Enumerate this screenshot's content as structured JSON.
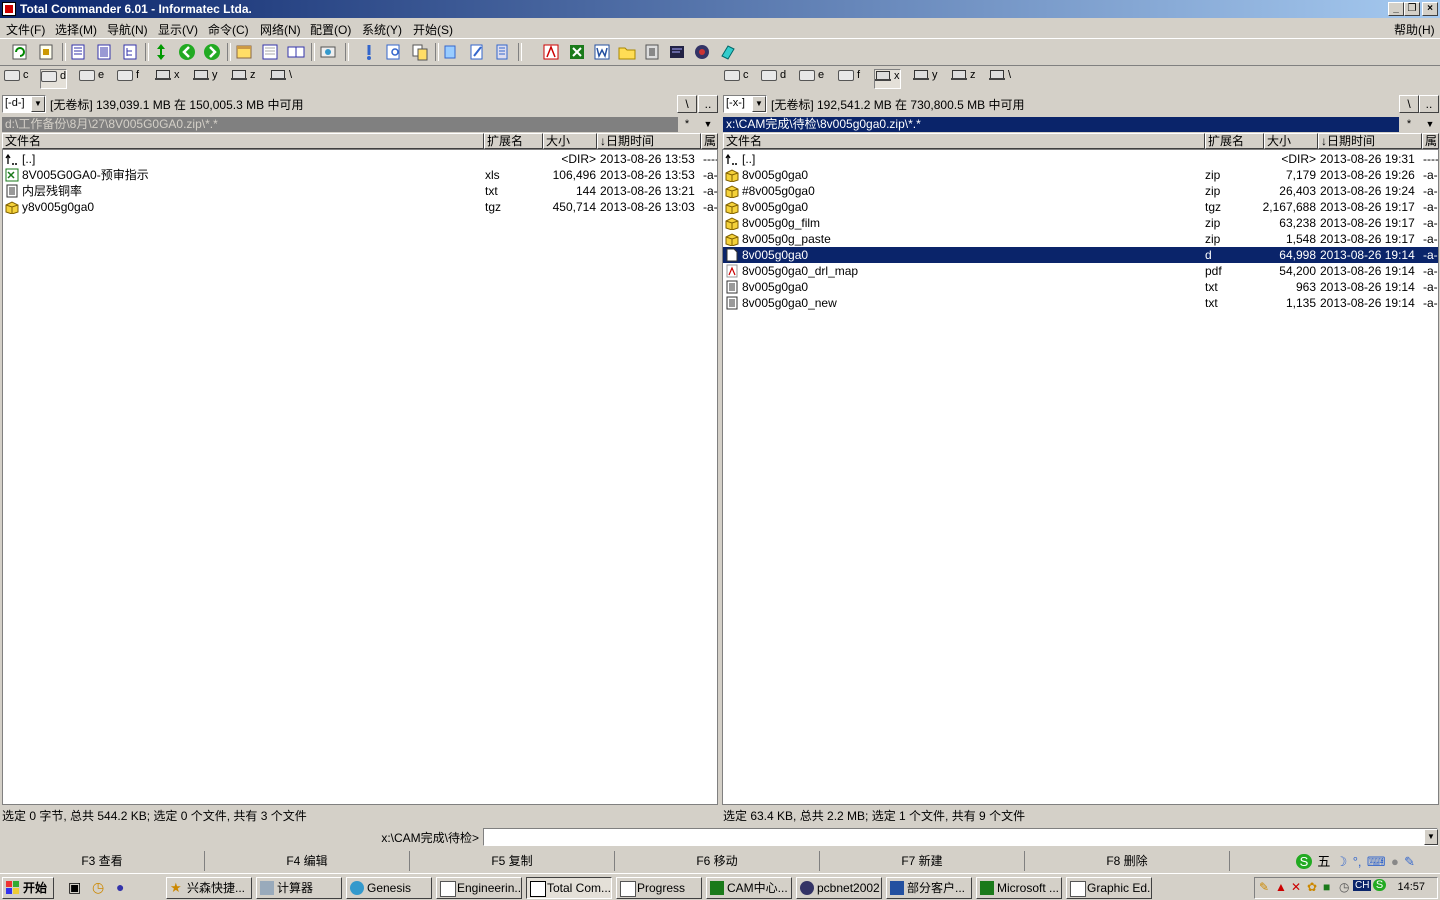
{
  "window": {
    "title": "Total Commander 6.01 - Informatec Ltda."
  },
  "menu": {
    "items": [
      "文件(F)",
      "选择(M)",
      "导航(N)",
      "显示(V)",
      "命令(C)",
      "网络(N)",
      "配置(O)",
      "系统(Y)",
      "开始(S)"
    ],
    "help": "帮助(H)"
  },
  "drives": {
    "letters": [
      "c",
      "d",
      "e",
      "f",
      "x",
      "y",
      "z",
      "\\"
    ]
  },
  "left": {
    "drive_combo": "[-d-]",
    "free_info": "[无卷标]  139,039.1 MB 在 150,005.3 MB 中可用",
    "root_btn": "\\",
    "up_btn": "..",
    "path": "d:\\工作备份\\8月\\27\\8V005G0GA0.zip\\*.*",
    "filter": "*",
    "headers": {
      "name": "文件名",
      "ext": "扩展名",
      "size": "大小",
      "date": "↓日期时间",
      "attr": "属"
    },
    "files": [
      {
        "name": "[..]",
        "ext": "",
        "size": "<DIR>",
        "date": "2013-08-26 13:53",
        "attr": "----",
        "icon": "up-dir"
      },
      {
        "name": "8V005G0GA0-预审指示",
        "ext": "xls",
        "size": "106,496",
        "date": "2013-08-26 13:53",
        "attr": "-a-",
        "icon": "excel"
      },
      {
        "name": "内层残铜率",
        "ext": "txt",
        "size": "144",
        "date": "2013-08-26 13:21",
        "attr": "-a-",
        "icon": "text"
      },
      {
        "name": "y8v005g0ga0",
        "ext": "tgz",
        "size": "450,714",
        "date": "2013-08-26 13:03",
        "attr": "-a-",
        "icon": "archive"
      }
    ],
    "status": "选定 0 字节, 总共 544.2 KB; 选定 0 个文件, 共有 3 个文件"
  },
  "right": {
    "drive_combo": "[-x-]",
    "free_info": "[无卷标]  192,541.2 MB 在 730,800.5 MB 中可用",
    "root_btn": "\\",
    "up_btn": "..",
    "path": "x:\\CAM完成\\待检\\8v005g0ga0.zip\\*.*",
    "filter": "*",
    "headers": {
      "name": "文件名",
      "ext": "扩展名",
      "size": "大小",
      "date": "↓日期时间",
      "attr": "属"
    },
    "files": [
      {
        "name": "[..]",
        "ext": "",
        "size": "<DIR>",
        "date": "2013-08-26 19:31",
        "attr": "----",
        "icon": "up-dir"
      },
      {
        "name": "8v005g0ga0",
        "ext": "zip",
        "size": "7,179",
        "date": "2013-08-26 19:26",
        "attr": "-a-",
        "icon": "archive"
      },
      {
        "name": "#8v005g0ga0",
        "ext": "zip",
        "size": "26,403",
        "date": "2013-08-26 19:24",
        "attr": "-a-",
        "icon": "archive"
      },
      {
        "name": "8v005g0ga0",
        "ext": "tgz",
        "size": "2,167,688",
        "date": "2013-08-26 19:17",
        "attr": "-a-",
        "icon": "archive"
      },
      {
        "name": "8v005g0g_film",
        "ext": "zip",
        "size": "63,238",
        "date": "2013-08-26 19:17",
        "attr": "-a-",
        "icon": "archive"
      },
      {
        "name": "8v005g0g_paste",
        "ext": "zip",
        "size": "1,548",
        "date": "2013-08-26 19:17",
        "attr": "-a-",
        "icon": "archive"
      },
      {
        "name": "8v005g0ga0",
        "ext": "d",
        "size": "64,998",
        "date": "2013-08-26 19:14",
        "attr": "-a-",
        "icon": "file",
        "selected": true
      },
      {
        "name": "8v005g0ga0_drl_map",
        "ext": "pdf",
        "size": "54,200",
        "date": "2013-08-26 19:14",
        "attr": "-a-",
        "icon": "pdf"
      },
      {
        "name": "8v005g0ga0",
        "ext": "txt",
        "size": "963",
        "date": "2013-08-26 19:14",
        "attr": "-a-",
        "icon": "text"
      },
      {
        "name": "8v005g0ga0_new",
        "ext": "txt",
        "size": "1,135",
        "date": "2013-08-26 19:14",
        "attr": "-a-",
        "icon": "text"
      }
    ],
    "status": "选定 63.4 KB, 总共 2.2 MB; 选定 1 个文件, 共有 9 个文件"
  },
  "cmdline": {
    "label": "x:\\CAM完成\\待检>",
    "value": ""
  },
  "fkeys": [
    "F3 查看",
    "F4 编辑",
    "F5 复制",
    "F6 移动",
    "F7 新建",
    "F8 删除"
  ],
  "ime": {
    "label": "五"
  },
  "taskbar": {
    "start": "开始",
    "tasks": [
      "兴森快捷...",
      "计算器",
      "Genesis",
      "Engineerin...",
      "Total Com...",
      "Progress",
      "CAM中心...",
      "pcbnet2002",
      "部分客户...",
      "Microsoft ...",
      "Graphic Ed..."
    ],
    "tray_lang": "CH",
    "clock": "14:57"
  },
  "colors": {
    "selection": "#0a246a",
    "face": "#d4d0c8",
    "inactive_path": "#808080"
  }
}
